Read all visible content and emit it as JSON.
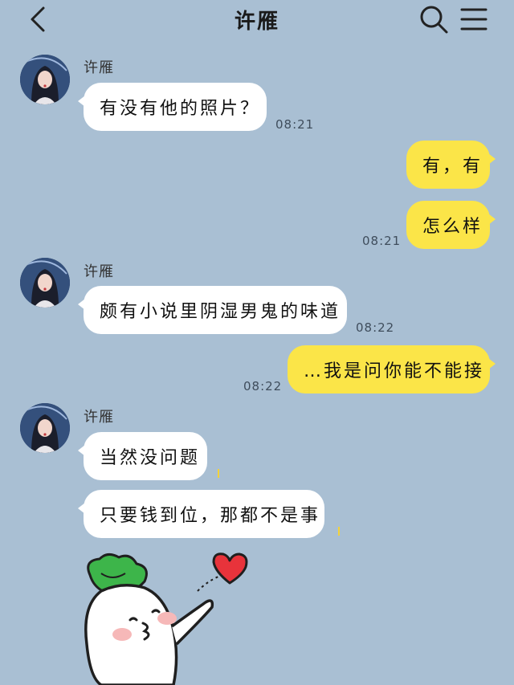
{
  "header": {
    "title": "许雁",
    "back_icon": "chevron-left-icon",
    "search_icon": "search-icon",
    "menu_icon": "hamburger-menu-icon"
  },
  "messages": [
    {
      "sender": "许雁",
      "text": "有没有他的照片？",
      "time": "08:21"
    },
    {
      "text": "有，有"
    },
    {
      "text": "怎么样",
      "time": "08:21"
    },
    {
      "sender": "许雁",
      "text": "颇有小说里阴湿男鬼的味道",
      "time": "08:22"
    },
    {
      "text": "…我是问你能不能接",
      "time": "08:22"
    },
    {
      "sender": "许雁",
      "text": "当然没问题"
    },
    {
      "text": "只要钱到位，那都不是事"
    }
  ],
  "sticker": {
    "icon": "radish-blowing-kiss-sticker"
  },
  "colors": {
    "background": "#a9bfd3",
    "incoming_bubble": "#ffffff",
    "outgoing_bubble": "#fbe548",
    "heart": "#e8333b",
    "leaf": "#3db54a"
  }
}
